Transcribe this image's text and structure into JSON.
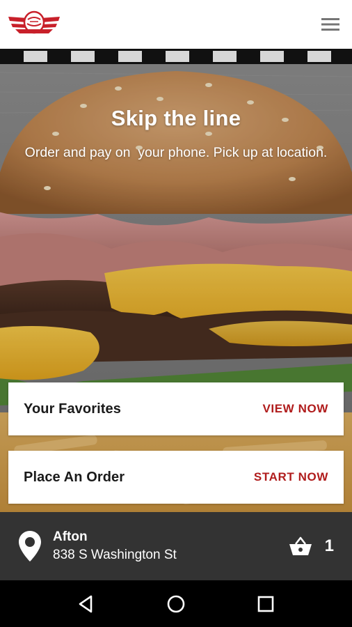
{
  "app": {
    "logo_icon": "restaurant-logo",
    "menu_icon": "hamburger-menu-icon"
  },
  "hero": {
    "title": "Skip the line",
    "subtitle": "Order and pay on  your phone. Pick up at location."
  },
  "cards": [
    {
      "label": "Your Favorites",
      "action": "VIEW NOW"
    },
    {
      "label": "Place An Order",
      "action": "START NOW"
    }
  ],
  "location": {
    "icon": "location-pin-icon",
    "name": "Afton",
    "address": "838 S Washington St"
  },
  "cart": {
    "icon": "basket-icon",
    "count": "1"
  },
  "colors": {
    "accent": "#b01c1c",
    "location_bar": "#333333",
    "logo_red": "#c8202a"
  },
  "system_nav": {
    "back_icon": "back-triangle-icon",
    "home_icon": "home-circle-icon",
    "recents_icon": "recents-square-icon"
  }
}
